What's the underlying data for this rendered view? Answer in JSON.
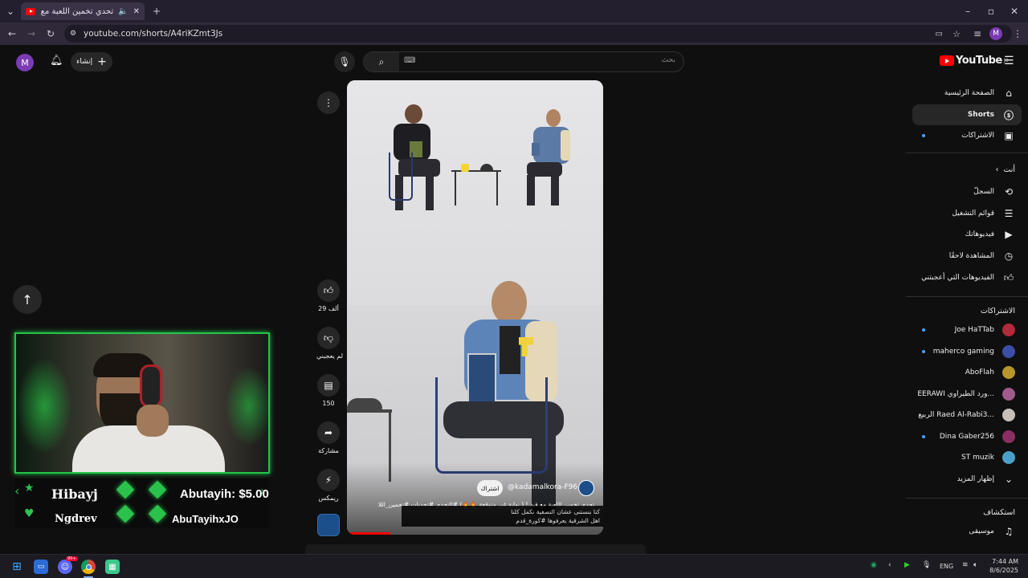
{
  "browser": {
    "tab_title": "تحدي تخمين اللعبة مع ثيم فيد...",
    "url": "youtube.com/shorts/A4riKZmt3Js",
    "profile_initial": "M"
  },
  "header": {
    "logo_text": "YouTube",
    "logo_region": "JO",
    "search_placeholder": "بحث",
    "create_label": "إنشاء",
    "avatar_initial": "M"
  },
  "sidebar": {
    "main": [
      {
        "label": "الصفحة الرئيسية",
        "icon": "home-icon"
      },
      {
        "label": "Shorts",
        "icon": "shorts-icon",
        "active": true
      },
      {
        "label": "الاشتراكات",
        "icon": "subscriptions-icon",
        "dot": true
      }
    ],
    "you_header": "أنت",
    "you": [
      {
        "label": "السجلّ",
        "icon": "history-icon"
      },
      {
        "label": "قوائم التشغيل",
        "icon": "playlist-icon"
      },
      {
        "label": "فيديوهاتك",
        "icon": "your-videos-icon"
      },
      {
        "label": "المشاهدة لاحقًا",
        "icon": "watch-later-icon"
      },
      {
        "label": "الفيديوهات التي أعجبتني",
        "icon": "like-icon"
      }
    ],
    "subs_header": "الاشتراكات",
    "subs": [
      {
        "label": "Joe HaTTab",
        "dot": true,
        "color": "#b22a3b"
      },
      {
        "label": "maherco gaming",
        "dot": true,
        "color": "#3b4fa8"
      },
      {
        "label": "AboFlah",
        "dot": false,
        "color": "#b8962a"
      },
      {
        "label": "...ورد الطيراوي EERAWI",
        "dot": false,
        "color": "#a05a8c"
      },
      {
        "label": "...Raed Al-Rabi3 الربيع",
        "dot": false,
        "color": "#c8c0b8"
      },
      {
        "label": "Dina Gaber256",
        "dot": true,
        "color": "#8a3060"
      },
      {
        "label": "ST muzik",
        "dot": false,
        "color": "#4aa0c8"
      }
    ],
    "show_more": "إظهار المزيد",
    "explore_header": "استكشاف",
    "explore": [
      {
        "label": "موسيقى",
        "icon": "music-icon"
      }
    ]
  },
  "short": {
    "channel": "@kadamalkora-F96",
    "subscribe_label": "اشتراك",
    "description": "تحدي تخمين اللعبة مع فيد ! ( نهاية غير متوقعة 🔥🔥) #التحدي #تحديات #تخمين_اللاعب",
    "subtitle_line1": "كنا بنستنى عشان التصفية نكمل كلنا",
    "subtitle_line2": "اهل الشرقية يعرفوها #كورة_قدم",
    "progress": 0.17
  },
  "actions": {
    "likes": "29 ألف",
    "dislike": "لم يعجبني",
    "comments": "150",
    "share": "مشاركة",
    "remix": "ريمكس"
  },
  "overlay": {
    "donors": [
      {
        "name": "Hibayj"
      },
      {
        "name": "Abutayih: $5.00"
      },
      {
        "name": "Ngdrev"
      },
      {
        "name": "AbuTayihxJO"
      }
    ]
  },
  "taskbar": {
    "lang": "ENG",
    "time": "7:44 AM",
    "date": "8/6/2025",
    "discord_badge": "99+"
  }
}
